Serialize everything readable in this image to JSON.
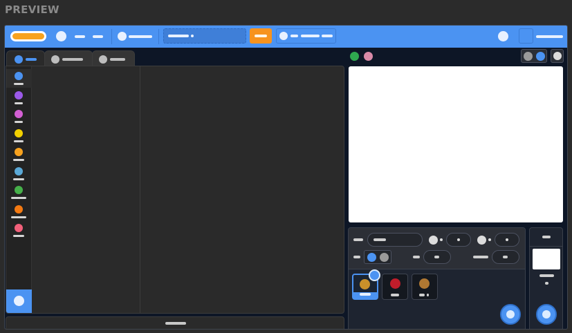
{
  "preview_label": "PREVIEW",
  "colors": {
    "accent": "#4b93f2",
    "orange": "#f7931e",
    "sidebar_dots": [
      "#4b93f2",
      "#9b59e8",
      "#d35fd3",
      "#f2d000",
      "#f7a21e",
      "#5aa8d6",
      "#46b04a",
      "#f47a12",
      "#f2607a"
    ]
  },
  "icons": {
    "traffic_light_green": "circle",
    "traffic_light_pink": "circle"
  }
}
